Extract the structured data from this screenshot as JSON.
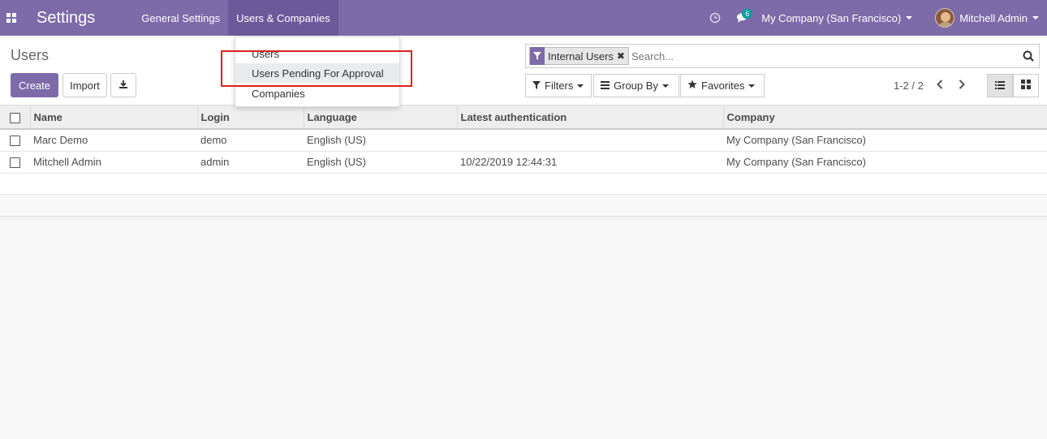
{
  "navbar": {
    "brand": "Settings",
    "menu": [
      {
        "label": "General Settings"
      },
      {
        "label": "Users & Companies"
      }
    ],
    "messages_badge": "6",
    "company": "My Company (San Francisco)",
    "user": "Mitchell Admin",
    "bg_color": "#7c6ba8"
  },
  "control_panel": {
    "breadcrumb": "Users",
    "create_label": "Create",
    "import_label": "Import",
    "search": {
      "facet_label": "Internal Users",
      "placeholder": "Search..."
    },
    "filters_label": "Filters",
    "groupby_label": "Group By",
    "favorites_label": "Favorites",
    "pager": "1-2 / 2"
  },
  "dropdown": {
    "items": [
      {
        "label": "Users"
      },
      {
        "label": "Users Pending For Approval"
      },
      {
        "label": "Companies"
      }
    ]
  },
  "table": {
    "columns": [
      "Name",
      "Login",
      "Language",
      "Latest authentication",
      "Company"
    ],
    "rows": [
      {
        "name": "Marc Demo",
        "login": "demo",
        "language": "English (US)",
        "latest_auth": "",
        "company": "My Company (San Francisco)"
      },
      {
        "name": "Mitchell Admin",
        "login": "admin",
        "language": "English (US)",
        "latest_auth": "10/22/2019 12:44:31",
        "company": "My Company (San Francisco)"
      }
    ]
  }
}
